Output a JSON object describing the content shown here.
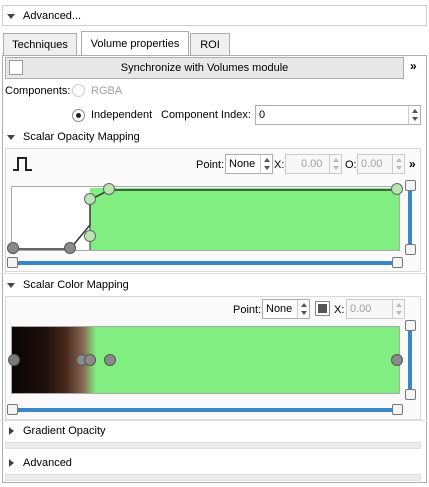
{
  "advanced_top": {
    "label": "Advanced..."
  },
  "tabs": [
    {
      "label": "Techniques"
    },
    {
      "label": "Volume properties"
    },
    {
      "label": "ROI"
    }
  ],
  "sync_button": {
    "label": "Synchronize with Volumes module"
  },
  "more_glyph": "»",
  "components": {
    "label": "Components:",
    "rgba_label": "RGBA",
    "independent_label": "Independent",
    "component_index_label": "Component Index:",
    "component_index_value": "0"
  },
  "opacity_mapping": {
    "title": "Scalar Opacity Mapping",
    "point_label": "Point:",
    "point_value": "None",
    "x_label": "X:",
    "x_value": "0.00",
    "o_label": "O:",
    "o_value": "0.00"
  },
  "color_mapping": {
    "title": "Scalar Color Mapping",
    "point_label": "Point:",
    "point_value": "None",
    "x_label": "X:",
    "x_value": "0.00"
  },
  "gradient_opacity": {
    "title": "Gradient Opacity"
  },
  "advanced_bottom": {
    "title": "Advanced"
  },
  "colors": {
    "accent": "#3a87c8",
    "curve_fill": "#80ee80",
    "swatch": "#555555"
  }
}
